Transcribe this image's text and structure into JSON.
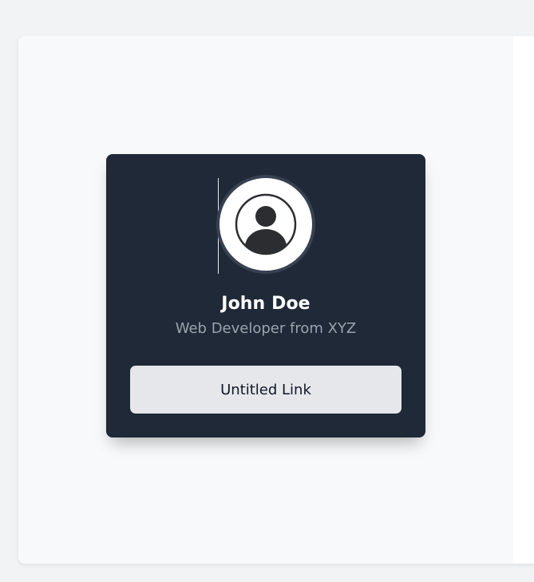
{
  "profile": {
    "avatar_icon": "user-circle-icon",
    "name": "John Doe",
    "subtitle": "Web Developer from XYZ",
    "link_label": "Untitled Link"
  },
  "colors": {
    "page_bg": "#f2f3f5",
    "canvas_bg": "#f8f9fb",
    "card_bg": "#1f2937",
    "avatar_ring": "#374151",
    "name_text": "#ffffff",
    "subtitle_text": "#9ca3af",
    "button_bg": "#e5e7eb",
    "button_text": "#111827"
  }
}
